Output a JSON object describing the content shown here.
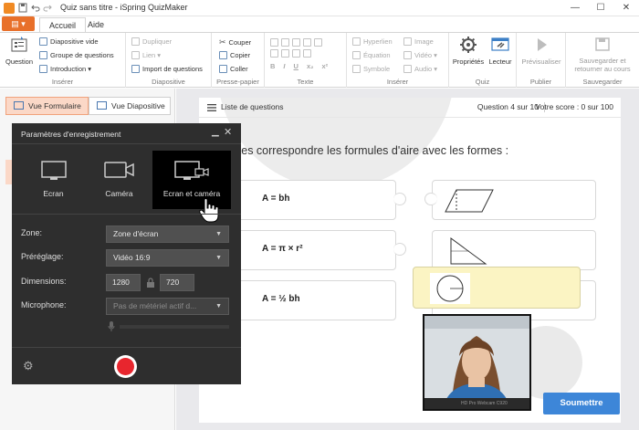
{
  "window": {
    "title": "Quiz sans titre - iSpring QuizMaker",
    "minimize": "—",
    "maximize": "☐",
    "close": "✕"
  },
  "tabs": {
    "file_label": "▤ ▾",
    "items": [
      "Accueil",
      "Aide"
    ]
  },
  "ribbon": {
    "inserer": {
      "label": "Insérer",
      "question": "Question",
      "items": [
        "Diapositive vide",
        "Groupe de questions",
        "Introduction ▾"
      ]
    },
    "diapositive": {
      "label": "Diapositive",
      "items": [
        "Dupliquer",
        "Lien ▾",
        "Import de questions"
      ]
    },
    "clipboard": {
      "label": "Presse-papier",
      "items": [
        "Couper",
        "Copier",
        "Coller"
      ]
    },
    "texte": {
      "label": "Texte",
      "row2": [
        "B",
        "I",
        "U",
        "x₂",
        "x²"
      ]
    },
    "inserer2": {
      "label": "Insérer",
      "col1": [
        "Hyperlien",
        "Équation",
        "Symbole"
      ],
      "col2": [
        "Image",
        "Vidéo ▾",
        "Audio ▾"
      ]
    },
    "quiz": {
      "label": "Quiz",
      "items": [
        "Propriétés",
        "Lecteur"
      ]
    },
    "publier": {
      "label": "Publier",
      "item": "Prévisualiser"
    },
    "sauvegarder": {
      "label": "Sauvegarder",
      "item_line1": "Sauvegarder et",
      "item_line2": "retourner au cours"
    }
  },
  "views": {
    "form": "Vue Formulaire",
    "slide": "Vue Diapositive"
  },
  "slide": {
    "list_label": "Liste de questions",
    "question_num": "Question 4 sur 10",
    "score": "Votre score : 0 sur 100",
    "question_text": "ites correspondre les formules d'aire avec les formes :",
    "formulas": [
      "A = bh",
      "A =  π  × r²",
      "A =  ½  bh"
    ],
    "submit": "Soumettre"
  },
  "dialog": {
    "title": "Paramètres d'enregistrement",
    "modes": [
      "Ecran",
      "Caméra",
      "Ecran et caméra"
    ],
    "active_mode": "Ecran et caméra",
    "labels": {
      "zone": "Zone:",
      "preset": "Préréglage:",
      "dimensions": "Dimensions:",
      "microphone": "Microphone:"
    },
    "zone_value": "Zone d'écran",
    "preset_value": "Vidéo 16:9",
    "width": "1280",
    "height": "720",
    "microphone_value": "Pas de métériel actif d..."
  },
  "webcam": {
    "label": "HD Pro Webcam C920"
  },
  "colors": {
    "accent_orange": "#e8702a",
    "record_red": "#e8262e",
    "submit_blue": "#3d86d8",
    "dialog_bg": "#2e2e2e",
    "puzzle_highlight": "#fbf4c3"
  }
}
